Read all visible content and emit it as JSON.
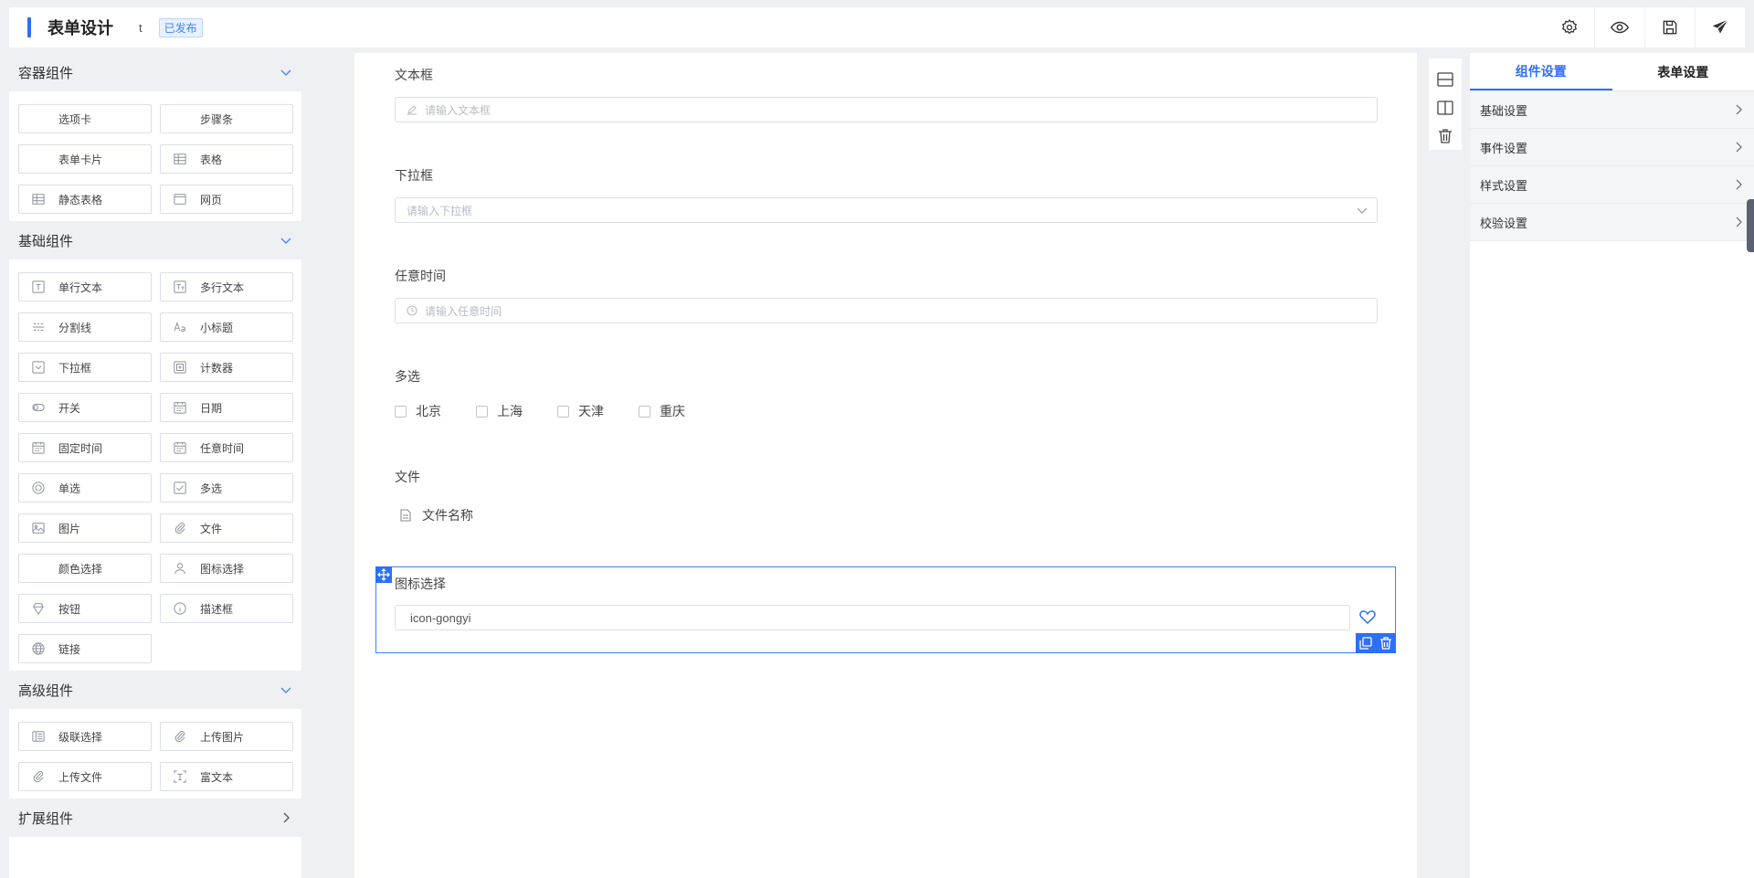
{
  "header": {
    "title": "表单设计",
    "form_name": "t",
    "status": "已发布",
    "tools": [
      "gear-icon",
      "eye-icon",
      "save-icon",
      "send-icon"
    ]
  },
  "left": {
    "groups": [
      {
        "title": "容器组件",
        "items": [
          {
            "label": "选项卡",
            "icon": ""
          },
          {
            "label": "步骤条",
            "icon": ""
          },
          {
            "label": "表单卡片",
            "icon": ""
          },
          {
            "label": "表格",
            "icon": "table-icon"
          },
          {
            "label": "静态表格",
            "icon": "table-icon"
          },
          {
            "label": "网页",
            "icon": "window-icon"
          }
        ]
      },
      {
        "title": "基础组件",
        "items": [
          {
            "label": "单行文本",
            "icon": "text-icon"
          },
          {
            "label": "多行文本",
            "icon": "textarea-icon"
          },
          {
            "label": "分割线",
            "icon": "divider-icon"
          },
          {
            "label": "小标题",
            "icon": "subtitle-icon"
          },
          {
            "label": "下拉框",
            "icon": "dropdown-icon"
          },
          {
            "label": "计数器",
            "icon": "counter-icon"
          },
          {
            "label": "开关",
            "icon": "switch-icon"
          },
          {
            "label": "日期",
            "icon": "calendar-icon"
          },
          {
            "label": "固定时间",
            "icon": "calendar-icon"
          },
          {
            "label": "任意时间",
            "icon": "calendar-icon"
          },
          {
            "label": "单选",
            "icon": "radio-icon"
          },
          {
            "label": "多选",
            "icon": "checkbox-icon"
          },
          {
            "label": "图片",
            "icon": "image-icon"
          },
          {
            "label": "文件",
            "icon": "paperclip-icon"
          },
          {
            "label": "颜色选择",
            "icon": ""
          },
          {
            "label": "图标选择",
            "icon": "user-icon"
          },
          {
            "label": "按钮",
            "icon": "button-icon"
          },
          {
            "label": "描述框",
            "icon": "info-icon"
          },
          {
            "label": "链接",
            "icon": "globe-icon"
          }
        ]
      },
      {
        "title": "高级组件",
        "items": [
          {
            "label": "级联选择",
            "icon": "cascade-icon"
          },
          {
            "label": "上传图片",
            "icon": "paperclip-icon"
          },
          {
            "label": "上传文件",
            "icon": "paperclip-icon"
          },
          {
            "label": "富文本",
            "icon": "richtext-icon"
          }
        ]
      },
      {
        "title": "扩展组件",
        "items": []
      }
    ]
  },
  "canvas": {
    "text_field": {
      "label": "文本框",
      "placeholder": "请输入文本框"
    },
    "select_field": {
      "label": "下拉框",
      "placeholder": "请输入下拉框"
    },
    "time_field": {
      "label": "任意时间",
      "placeholder": "请输入任意时间"
    },
    "multi_field": {
      "label": "多选",
      "options": [
        "北京",
        "上海",
        "天津",
        "重庆"
      ]
    },
    "file_field": {
      "label": "文件",
      "file_name": "文件名称"
    },
    "icon_field": {
      "label": "图标选择",
      "value": "icon-gongyi"
    }
  },
  "right": {
    "tabs": [
      "组件设置",
      "表单设置"
    ],
    "active_tab": "组件设置",
    "rows": [
      "基础设置",
      "事件设置",
      "样式设置",
      "校验设置"
    ]
  }
}
